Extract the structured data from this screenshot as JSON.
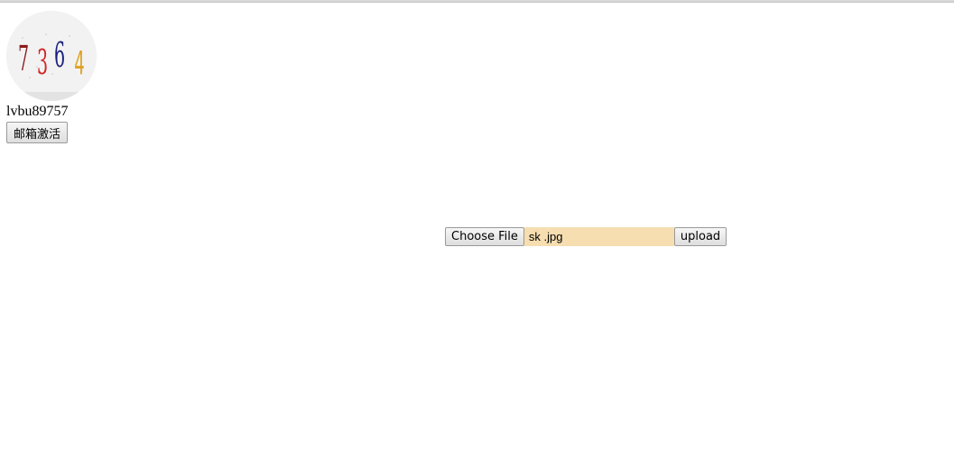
{
  "captcha": {
    "digits": [
      "7",
      "3",
      "6",
      "4"
    ],
    "colors": [
      "#8b1a1a",
      "#d22828",
      "#1a1f7a",
      "#e0a020"
    ]
  },
  "user": {
    "username": "lvbu89757"
  },
  "account": {
    "activate_label": "邮箱激活"
  },
  "uploader": {
    "choose_label": "Choose File",
    "file_name": "sk .jpg",
    "upload_label": "upload"
  }
}
